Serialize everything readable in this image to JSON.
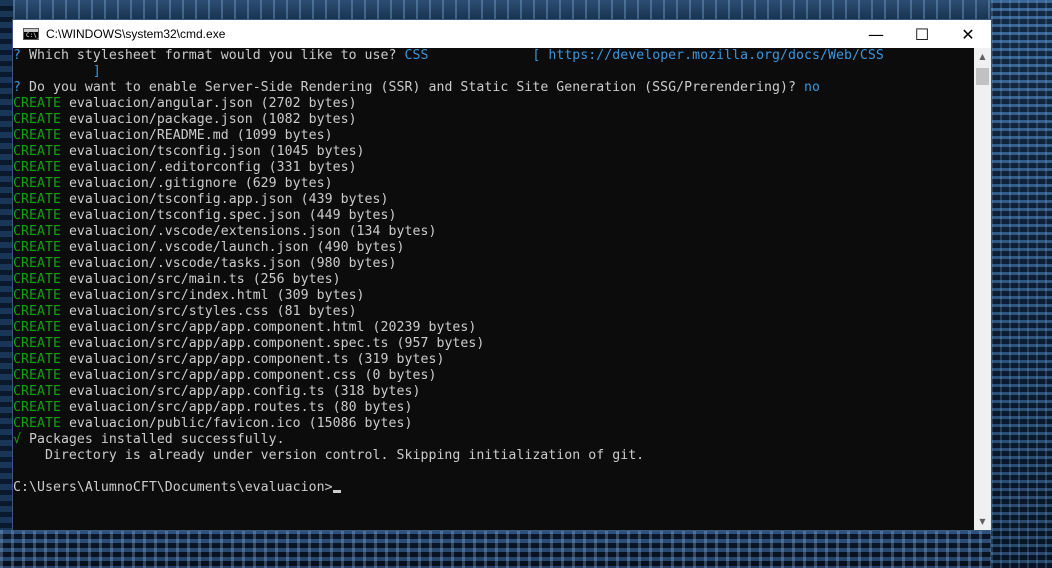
{
  "window": {
    "title": "C:\\WINDOWS\\system32\\cmd.exe",
    "icon_prompt": "C:\\_",
    "controls": {
      "minimize": "—",
      "maximize": "☐",
      "close": "✕"
    }
  },
  "console": {
    "stylesheet_prompt": {
      "mark": "?",
      "question": " Which stylesheet format would you like to use?",
      "answer": "CSS",
      "gap": "             ",
      "link": "[ https://developer.mozilla.org/docs/Web/CSS",
      "link_close": "          ]"
    },
    "ssr_prompt": {
      "mark": "?",
      "question": " Do you want to enable Server-Side Rendering (SSR) and Static Site Generation (SSG/Prerendering)?",
      "answer": "no"
    },
    "create_label": "CREATE",
    "created_files": [
      "evaluacion/angular.json (2702 bytes)",
      "evaluacion/package.json (1082 bytes)",
      "evaluacion/README.md (1099 bytes)",
      "evaluacion/tsconfig.json (1045 bytes)",
      "evaluacion/.editorconfig (331 bytes)",
      "evaluacion/.gitignore (629 bytes)",
      "evaluacion/tsconfig.app.json (439 bytes)",
      "evaluacion/tsconfig.spec.json (449 bytes)",
      "evaluacion/.vscode/extensions.json (134 bytes)",
      "evaluacion/.vscode/launch.json (490 bytes)",
      "evaluacion/.vscode/tasks.json (980 bytes)",
      "evaluacion/src/main.ts (256 bytes)",
      "evaluacion/src/index.html (309 bytes)",
      "evaluacion/src/styles.css (81 bytes)",
      "evaluacion/src/app/app.component.html (20239 bytes)",
      "evaluacion/src/app/app.component.spec.ts (957 bytes)",
      "evaluacion/src/app/app.component.ts (319 bytes)",
      "evaluacion/src/app/app.component.css (0 bytes)",
      "evaluacion/src/app/app.config.ts (318 bytes)",
      "evaluacion/src/app/app.routes.ts (80 bytes)",
      "evaluacion/public/favicon.ico (15086 bytes)"
    ],
    "success": {
      "mark": "√",
      "text": " Packages installed successfully."
    },
    "git_message": "    Directory is already under version control. Skipping initialization of git.",
    "prompt": "C:\\Users\\AlumnoCFT\\Documents\\evaluacion>"
  },
  "scrollbar": {
    "up_icon": "▲",
    "down_icon": "▼"
  },
  "colors": {
    "console_bg": "#0c0c0c",
    "text": "#cccccc",
    "cyan": "#3a96dd",
    "green": "#13a10e"
  }
}
